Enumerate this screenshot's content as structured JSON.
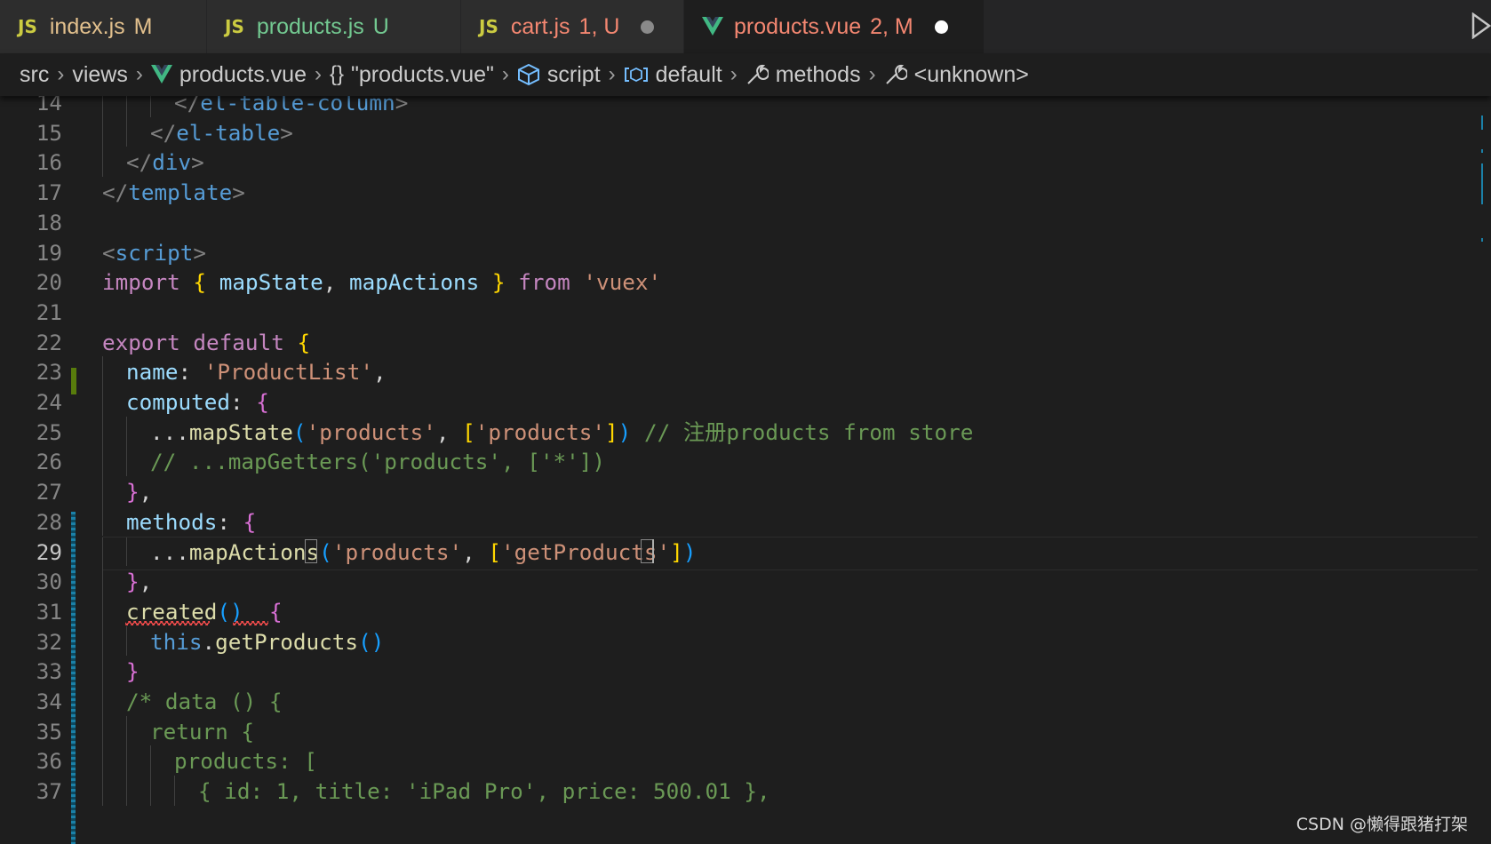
{
  "tabs": [
    {
      "badge": "JS",
      "name": "index.js",
      "status": "M",
      "name_color": "#e2c08d",
      "status_color": "#e2c08d"
    },
    {
      "badge": "JS",
      "name": "products.js",
      "status": "U",
      "name_color": "#73c991",
      "status_color": "#73c991"
    },
    {
      "badge": "JS",
      "name": "cart.js",
      "status": "1, U",
      "name_color": "#f48771",
      "status_color": "#f48771"
    },
    {
      "badge": "vue-icon",
      "name": "products.vue",
      "status": "2, M",
      "name_color": "#f48771",
      "status_color": "#f48771",
      "active": true
    }
  ],
  "breadcrumb": [
    {
      "label": "src",
      "icon": ""
    },
    {
      "label": "views",
      "icon": ""
    },
    {
      "label": "products.vue",
      "icon": "vue-icon"
    },
    {
      "label": "\"products.vue\"",
      "icon": "braces-icon"
    },
    {
      "label": "script",
      "icon": "cube-icon"
    },
    {
      "label": "default",
      "icon": "variable-icon"
    },
    {
      "label": "methods",
      "icon": "wrench-icon"
    },
    {
      "label": "<unknown>",
      "icon": "wrench-icon"
    }
  ],
  "editor": {
    "line_numbers": [
      "14",
      "15",
      "16",
      "17",
      "18",
      "19",
      "20",
      "21",
      "22",
      "23",
      "24",
      "25",
      "26",
      "27",
      "28",
      "29",
      "30",
      "31",
      "32",
      "33",
      "34",
      "35",
      "36",
      "37"
    ],
    "active_line": "29",
    "lines": [
      [
        [
          "p",
          "</"
        ],
        [
          "k",
          "el-table-column"
        ],
        [
          "p",
          ">"
        ]
      ],
      [
        [
          "p",
          "</"
        ],
        [
          "k",
          "el-table"
        ],
        [
          "p",
          ">"
        ]
      ],
      [
        [
          "p",
          "</"
        ],
        [
          "k",
          "div"
        ],
        [
          "p",
          ">"
        ]
      ],
      [
        [
          "p",
          "</"
        ],
        [
          "k",
          "template"
        ],
        [
          "p",
          ">"
        ]
      ],
      [],
      [
        [
          "p",
          "<"
        ],
        [
          "k",
          "script"
        ],
        [
          "p",
          ">"
        ]
      ],
      [
        [
          "kw",
          "import"
        ],
        [
          "t",
          " "
        ],
        [
          "b1",
          "{"
        ],
        [
          "t",
          " "
        ],
        [
          "v",
          "mapState"
        ],
        [
          "t",
          ", "
        ],
        [
          "v",
          "mapActions"
        ],
        [
          "t",
          " "
        ],
        [
          "b1",
          "}"
        ],
        [
          "t",
          " "
        ],
        [
          "kw",
          "from"
        ],
        [
          "t",
          " "
        ],
        [
          "s",
          "'vuex'"
        ]
      ],
      [],
      [
        [
          "kw",
          "export"
        ],
        [
          "t",
          " "
        ],
        [
          "kw",
          "default"
        ],
        [
          "t",
          " "
        ],
        [
          "b1",
          "{"
        ]
      ],
      [
        [
          "v",
          "name"
        ],
        [
          "t",
          ": "
        ],
        [
          "s",
          "'ProductList'"
        ],
        [
          "t",
          ","
        ]
      ],
      [
        [
          "v",
          "computed"
        ],
        [
          "t",
          ": "
        ],
        [
          "b2",
          "{"
        ]
      ],
      [
        [
          "t",
          "..."
        ],
        [
          "f",
          "mapState"
        ],
        [
          "b3",
          "("
        ],
        [
          "s",
          "'products'"
        ],
        [
          "t",
          ", "
        ],
        [
          "b1",
          "["
        ],
        [
          "s",
          "'products'"
        ],
        [
          "b1",
          "]"
        ],
        [
          "b3",
          ")"
        ],
        [
          "t",
          " "
        ],
        [
          "c",
          "// 注册products from store"
        ]
      ],
      [
        [
          "c",
          "// ...mapGetters('products', ['*'])"
        ]
      ],
      [
        [
          "b2",
          "}"
        ],
        [
          "t",
          ","
        ]
      ],
      [
        [
          "v",
          "methods"
        ],
        [
          "t",
          ": "
        ],
        [
          "b2",
          "{"
        ]
      ],
      [
        [
          "t",
          "..."
        ],
        [
          "f",
          "mapActions"
        ],
        [
          "b3",
          "("
        ],
        [
          "s",
          "'products'"
        ],
        [
          "t",
          ", "
        ],
        [
          "b1",
          "["
        ],
        [
          "s",
          "'getProducts'"
        ],
        [
          "b1",
          "]"
        ],
        [
          "b3",
          ")"
        ]
      ],
      [
        [
          "b2",
          "}"
        ],
        [
          "t",
          ","
        ]
      ],
      [
        [
          "f",
          "created"
        ],
        [
          "b3",
          "()"
        ],
        [
          "t",
          "  "
        ],
        [
          "b2",
          "{"
        ]
      ],
      [
        [
          "th",
          "this"
        ],
        [
          "t",
          "."
        ],
        [
          "f",
          "getProducts"
        ],
        [
          "b3",
          "()"
        ]
      ],
      [
        [
          "b2",
          "}"
        ]
      ],
      [
        [
          "c",
          "/* data () {"
        ]
      ],
      [
        [
          "c",
          "return {"
        ]
      ],
      [
        [
          "c",
          "products: ["
        ]
      ],
      [
        [
          "c",
          "{ id: 1, title: 'iPad Pro', price: 500.01 },"
        ]
      ]
    ],
    "indent_levels": [
      3,
      2,
      1,
      0,
      0,
      0,
      0,
      0,
      0,
      1,
      1,
      2,
      2,
      1,
      1,
      2,
      1,
      1,
      2,
      1,
      1,
      2,
      3,
      4
    ]
  },
  "watermark": "CSDN @懒得跟猪打架"
}
